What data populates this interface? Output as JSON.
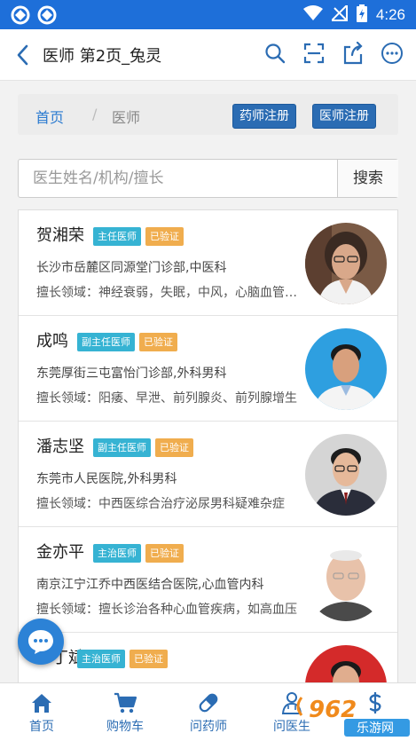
{
  "status_bar": {
    "time": "4:26"
  },
  "header": {
    "title": "医师 第2页_兔灵"
  },
  "breadcrumb": {
    "home": "首页",
    "separator": "/",
    "current": "医师"
  },
  "buttons": {
    "pharmacist_register": "药师注册",
    "doctor_register": "医师注册"
  },
  "search": {
    "placeholder": "医生姓名/机构/擅长",
    "button": "搜索"
  },
  "doctors": [
    {
      "name": "贺湘荣",
      "title": "主任医师",
      "verified": "已验证",
      "hospital": "长沙市岳麓区同源堂门诊部,中医科",
      "skill": "擅长领域：神经衰弱，失眠，中风，心脑血管疾病"
    },
    {
      "name": "成鸣",
      "title": "副主任医师",
      "verified": "已验证",
      "hospital": "东莞厚街三屯富怡门诊部,外科男科",
      "skill": "擅长领域：阳痿、早泄、前列腺炎、前列腺增生"
    },
    {
      "name": "潘志坚",
      "title": "副主任医师",
      "verified": "已验证",
      "hospital": "东莞市人民医院,外科男科",
      "skill": "擅长领域：中西医综合治疗泌尿男科疑难杂症"
    },
    {
      "name": "金亦平",
      "title": "主治医师",
      "verified": "已验证",
      "hospital": "南京江宁江乔中西医结合医院,心血管内科",
      "skill": "擅长领域：擅长诊治各种心血管疾病，如高血压"
    },
    {
      "name": "丁斌",
      "title": "主治医师",
      "verified": "已验证",
      "hospital": "",
      "skill": ""
    }
  ],
  "bottom_nav": [
    {
      "label": "首页",
      "icon": "home-icon"
    },
    {
      "label": "购物车",
      "icon": "cart-icon"
    },
    {
      "label": "问药师",
      "icon": "pill-icon"
    },
    {
      "label": "问医生",
      "icon": "doctor-icon"
    },
    {
      "label": "",
      "icon": "price-icon"
    }
  ],
  "watermark": {
    "text": "962",
    "sub": "乐游网"
  },
  "colors": {
    "status_bar": "#1e6fd9",
    "primary": "#2b6cb3",
    "badge_title": "#36b3d3",
    "badge_verified": "#f0ad4e"
  }
}
